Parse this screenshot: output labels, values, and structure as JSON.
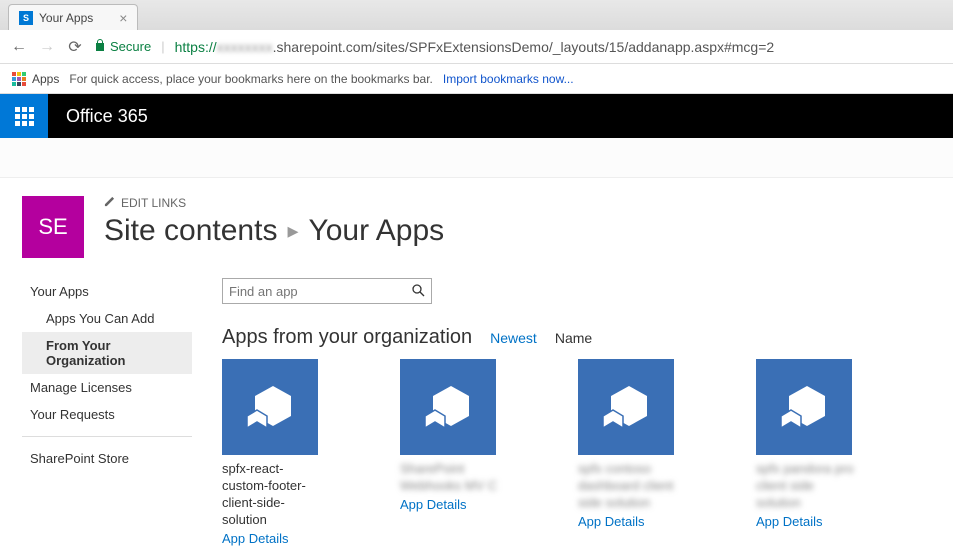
{
  "browser": {
    "tab_title": "Your Apps",
    "secure_label": "Secure",
    "url_proto": "https://",
    "url_blur": "xxxxxxxx",
    "url_rest": ".sharepoint.com/sites/SPFxExtensionsDemo/_layouts/15/addanapp.aspx#mcg=2",
    "apps_label": "Apps",
    "bookmark_hint": "For quick access, place your bookmarks here on the bookmarks bar.",
    "import_bookmarks": "Import bookmarks now..."
  },
  "suite": {
    "title": "Office 365"
  },
  "header": {
    "site_initials": "SE",
    "edit_links": "EDIT LINKS",
    "breadcrumb_root": "Site contents",
    "breadcrumb_current": "Your Apps"
  },
  "left_nav": {
    "your_apps": "Your Apps",
    "apps_you_can_add": "Apps You Can Add",
    "from_your_org": "From Your Organization",
    "manage_licenses": "Manage Licenses",
    "your_requests": "Your Requests",
    "sharepoint_store": "SharePoint Store"
  },
  "main": {
    "search_placeholder": "Find an app",
    "section_title": "Apps from your organization",
    "sort_newest": "Newest",
    "sort_name": "Name",
    "app_details_label": "App Details",
    "apps": [
      {
        "name": "spfx-react-custom-footer-client-side-solution",
        "blurred": false
      },
      {
        "name": "SharePoint Webhooks MV C",
        "blurred": true
      },
      {
        "name": "spfx contoso dashboard client side solution",
        "blurred": true
      },
      {
        "name": "spfx pandora pro client side solution",
        "blurred": true
      }
    ]
  }
}
